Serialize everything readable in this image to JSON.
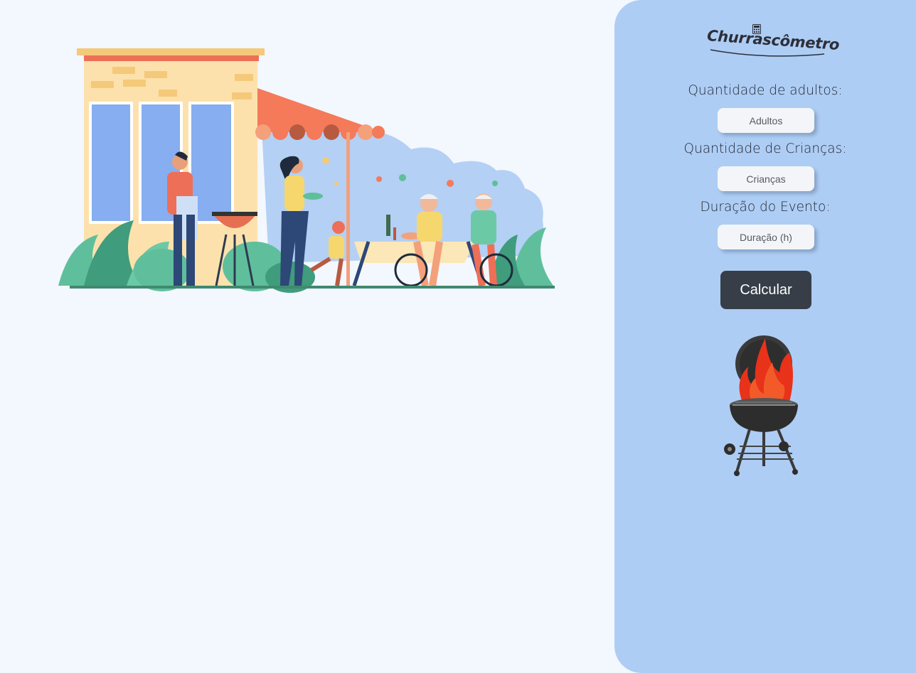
{
  "brand": {
    "logo_text": "Churrascômetro"
  },
  "form": {
    "adults": {
      "label": "Quantidade de adultos:",
      "placeholder": "Adultos"
    },
    "children": {
      "label": "Quantidade de Crianças:",
      "placeholder": "Crianças"
    },
    "duration": {
      "label": "Duração do Evento:",
      "placeholder": "Duração (h)"
    },
    "submit_label": "Calcular"
  },
  "colors": {
    "page_background": "#f3f7fe",
    "panel_background": "#aecdf4",
    "button_background": "#373e48",
    "button_text": "#ffffff"
  },
  "icons": [
    "barbecue-party-illustration",
    "calculator-icon",
    "grill-with-flames-image"
  ]
}
